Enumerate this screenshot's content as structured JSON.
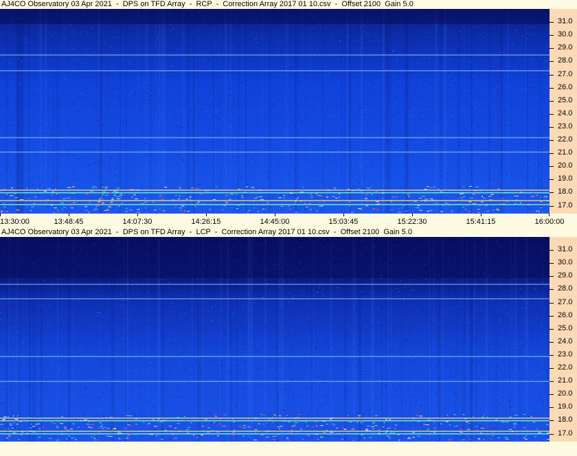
{
  "panels": [
    {
      "title": "AJ4CO Observatory 03 Apr 2021  -  DPS on TFD Array  -  RCP  -  Correction Array 2017 01 10.csv  -  Offset 2100  Gain 5.0",
      "polarization": "RCP"
    },
    {
      "title": "AJ4CO Observatory 03 Apr 2021  -  DPS on TFD Array  -  LCP  -  Correction Array 2017 01 10.csv  -  Offset 2100  Gain 5.0",
      "polarization": "LCP"
    }
  ],
  "chart_data": [
    {
      "type": "heatmap",
      "title": "AJ4CO Observatory 03 Apr 2021  -  DPS on TFD Array  -  RCP  -  Correction Array 2017 01 10.csv  -  Offset 2100  Gain 5.0",
      "x_tick_labels": [
        "13:30:00",
        "13:48:45",
        "14:07:30",
        "14:26:15",
        "14:45:00",
        "15:03:45",
        "15:22:30",
        "15:41:15",
        "16:00:00"
      ],
      "xlim": [
        "13:30:00",
        "16:00:00"
      ],
      "y_tick_labels": [
        "17.0",
        "18.0",
        "19.0",
        "20.0",
        "21.0",
        "22.0",
        "23.0",
        "24.0",
        "25.0",
        "26.0",
        "27.0",
        "28.0",
        "29.0",
        "30.0",
        "31.0"
      ],
      "ylim": [
        16.4,
        32.0
      ],
      "colormap": "blue",
      "notable_bands": [
        17.1,
        17.4,
        18.0,
        18.2,
        21.1,
        22.2,
        27.3,
        28.5
      ]
    },
    {
      "type": "heatmap",
      "title": "AJ4CO Observatory 03 Apr 2021  -  DPS on TFD Array  -  LCP  -  Correction Array 2017 01 10.csv  -  Offset 2100  Gain 5.0",
      "x_tick_labels": [],
      "y_tick_labels": [
        "17.0",
        "18.0",
        "19.0",
        "20.0",
        "21.0",
        "22.0",
        "23.0",
        "24.0",
        "25.0",
        "26.0",
        "27.0",
        "28.0",
        "29.0",
        "30.0",
        "31.0"
      ],
      "ylim": [
        16.4,
        32.0
      ],
      "colormap": "blue",
      "notable_bands": [
        17.0,
        17.2,
        18.0,
        18.2,
        21.0,
        22.9,
        27.3,
        28.4
      ]
    }
  ]
}
